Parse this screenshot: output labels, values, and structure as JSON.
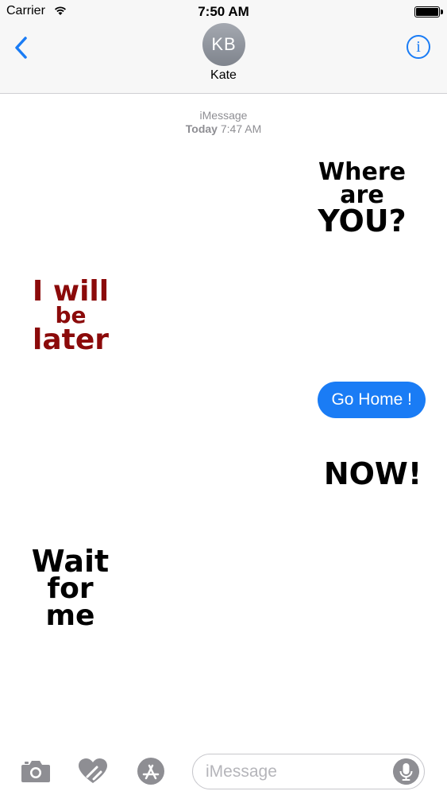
{
  "status_bar": {
    "carrier": "Carrier",
    "time": "7:50 AM"
  },
  "header": {
    "avatar_initials": "KB",
    "contact_name": "Kate",
    "info_glyph": "i"
  },
  "conversation": {
    "service": "iMessage",
    "timestamp_day": "Today",
    "timestamp_time": "7:47 AM"
  },
  "messages": [
    {
      "type": "sticker",
      "side": "right",
      "lines": [
        "Where",
        "are",
        "YOU?"
      ],
      "color": "#000000"
    },
    {
      "type": "sticker",
      "side": "left",
      "lines": [
        "I will",
        "be",
        "later"
      ],
      "color": "#8b0a0a"
    },
    {
      "type": "bubble",
      "side": "right",
      "text": "Go Home !",
      "color": "#1a7cf5"
    },
    {
      "type": "sticker",
      "side": "right",
      "lines": [
        "NOW!"
      ],
      "color": "#000000"
    },
    {
      "type": "sticker",
      "side": "left",
      "lines": [
        "Wait",
        "for",
        "me"
      ],
      "color": "#000000"
    }
  ],
  "toolbar": {
    "icons": [
      "camera-icon",
      "digital-touch-heart-icon",
      "app-store-icon",
      "microphone-icon"
    ],
    "input_placeholder": "iMessage"
  },
  "colors": {
    "accent": "#1a7cf5",
    "sticker_red": "#8b0a0a"
  }
}
